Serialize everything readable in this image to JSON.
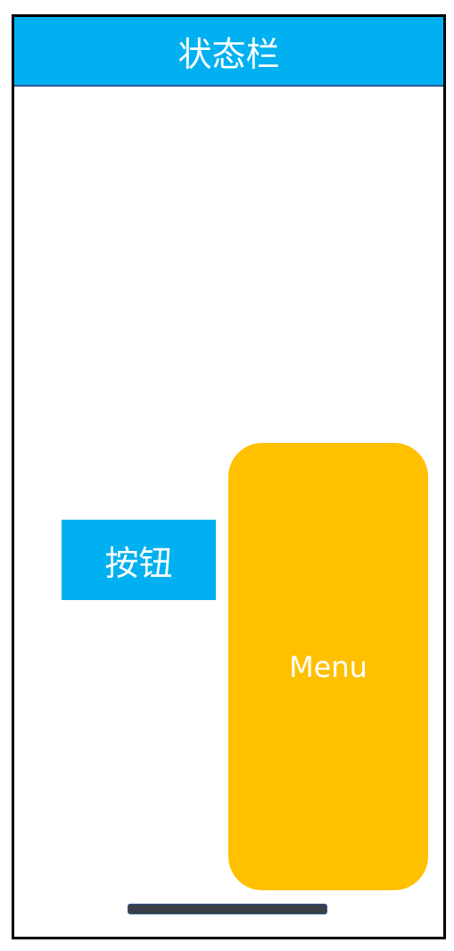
{
  "status_bar": {
    "label": "状态栏",
    "color": "#00B0F0"
  },
  "button": {
    "label": "按钮",
    "color": "#00B0F0"
  },
  "menu": {
    "label": "Menu",
    "color": "#FFC000"
  },
  "home_indicator": {
    "color": "#3A3F47"
  }
}
